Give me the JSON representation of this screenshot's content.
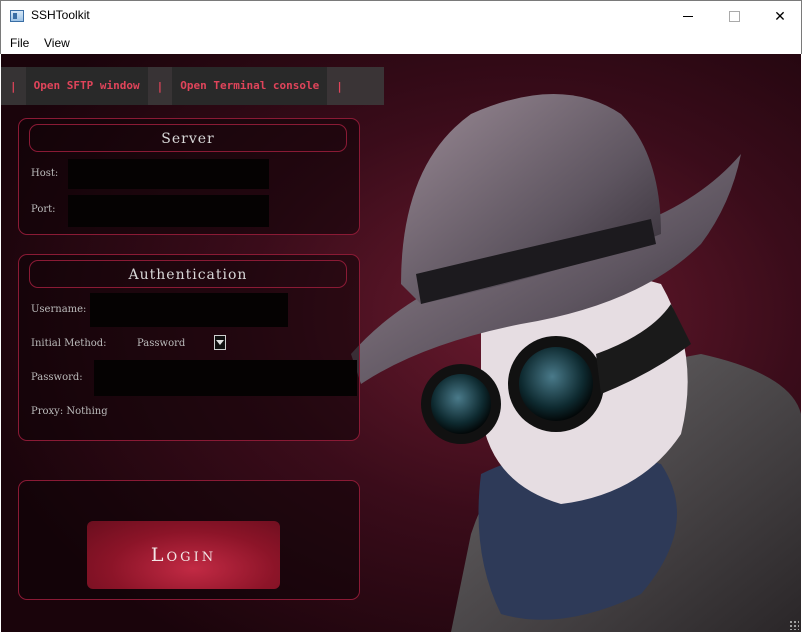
{
  "window": {
    "title": "SSHToolkit"
  },
  "menubar": {
    "file_label": "File",
    "view_label": "View"
  },
  "toolbar": {
    "separator": "|",
    "sftp_label": "Open SFTP window",
    "terminal_label": "Open Terminal console"
  },
  "server": {
    "title": "Server",
    "host_label": "Host:",
    "host_value": "",
    "port_label": "Port:",
    "port_value": ""
  },
  "auth": {
    "title": "Authentication",
    "username_label": "Username:",
    "username_value": "",
    "method_label": "Initial Method:",
    "method_value": "Password",
    "password_label": "Password:",
    "password_value": "",
    "proxy_label": "Proxy: Nothing"
  },
  "login": {
    "label": "Login"
  },
  "colors": {
    "accent": "#e0445a",
    "group_border": "#8a1a35",
    "button_fill": "#8c1428",
    "background": "#24060f"
  }
}
